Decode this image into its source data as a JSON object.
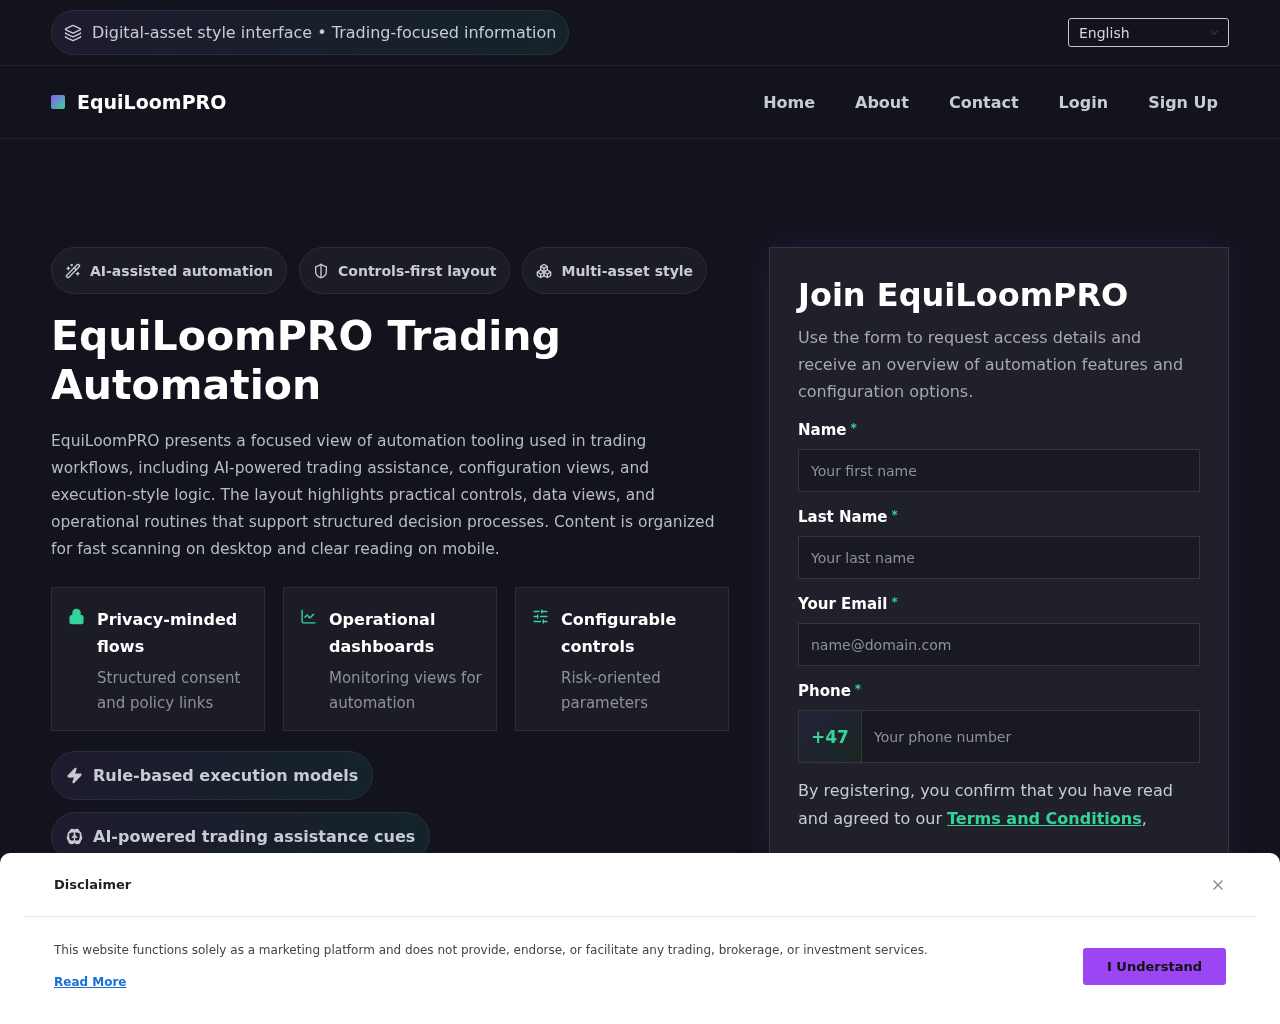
{
  "top_bar": {
    "tagline": "Digital-asset style interface • Trading-focused information",
    "language": "English"
  },
  "nav": {
    "brand": "EquiLoomPRO",
    "links": [
      "Home",
      "About",
      "Contact",
      "Login",
      "Sign Up"
    ]
  },
  "hero": {
    "badges": [
      "AI-assisted automation",
      "Controls-first layout",
      "Multi-asset style"
    ],
    "title": "EquiLoomPRO Trading Automation",
    "intro": "EquiLoomPRO presents a focused view of automation tooling used in trading workflows, including AI-powered trading assistance, configuration views, and execution-style logic. The layout highlights practical controls, data views, and operational routines that support structured decision processes. Content is organized for fast scanning on desktop and clear reading on mobile.",
    "features": [
      {
        "title": "Privacy-minded flows",
        "text": "Structured consent and policy links"
      },
      {
        "title": "Operational dashboards",
        "text": "Monitoring views for automation"
      },
      {
        "title": "Configurable controls",
        "text": "Risk-oriented parameters"
      }
    ],
    "pills": [
      "Rule-based execution models",
      "AI-powered trading assistance cues"
    ]
  },
  "form": {
    "title": "Join EquiLoomPRO",
    "subtitle": "Use the form to request access details and receive an overview of automation features and configuration options.",
    "required_mark": "*",
    "fields": [
      {
        "kind": "text",
        "label": "Name",
        "required": true,
        "placeholder": "Your first name"
      },
      {
        "kind": "text",
        "label": "Last Name",
        "required": true,
        "placeholder": "Your last name"
      },
      {
        "kind": "text",
        "label": "Your Email",
        "required": true,
        "placeholder": "name@domain.com"
      },
      {
        "kind": "phone",
        "label": "Phone",
        "required": true,
        "prefix": "+47",
        "placeholder": "Your phone number"
      }
    ],
    "consent": "By registering, you confirm that you have read and agreed to our",
    "consent_link": "Terms and Conditions",
    "consent_after": ","
  },
  "disclaimer": {
    "title": "Disclaimer",
    "text": "This website functions solely as a marketing platform and does not provide, endorse, or facilitate any trading, brokerage, or investment services.",
    "link": "Read More",
    "button": "I Understand"
  }
}
